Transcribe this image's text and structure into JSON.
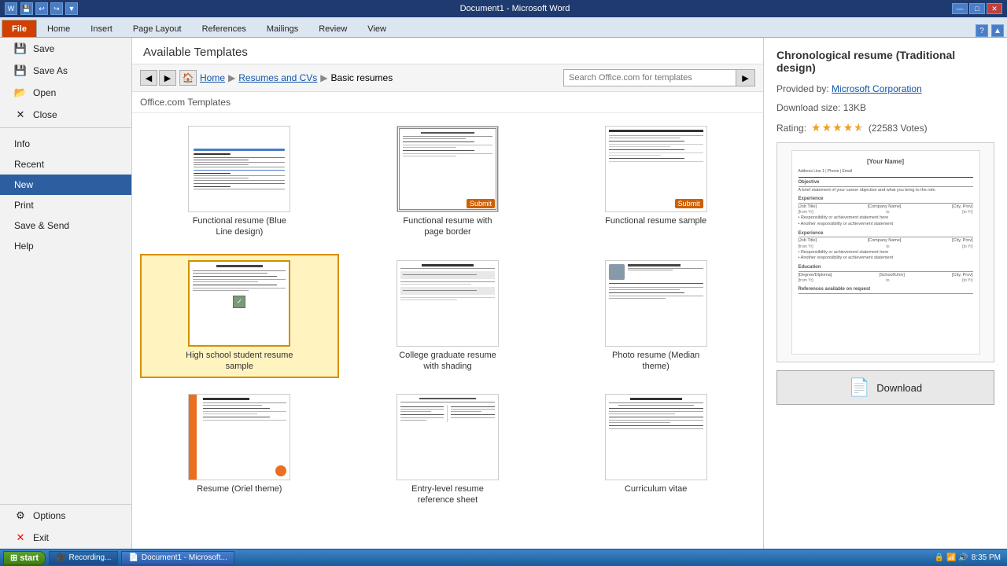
{
  "titleBar": {
    "title": "Document1  -  Microsoft Word",
    "controls": [
      "—",
      "□",
      "✕"
    ]
  },
  "tabs": [
    {
      "label": "File",
      "active": true
    },
    {
      "label": "Home",
      "active": false
    },
    {
      "label": "Insert",
      "active": false
    },
    {
      "label": "Page Layout",
      "active": false
    },
    {
      "label": "References",
      "active": false
    },
    {
      "label": "Mailings",
      "active": false
    },
    {
      "label": "Review",
      "active": false
    },
    {
      "label": "View",
      "active": false
    }
  ],
  "sidebar": {
    "items": [
      {
        "label": "Save",
        "icon": "💾",
        "active": false
      },
      {
        "label": "Save As",
        "icon": "💾",
        "active": false
      },
      {
        "label": "Open",
        "icon": "📂",
        "active": false
      },
      {
        "label": "Close",
        "icon": "✕",
        "active": false
      },
      {
        "label": "Info",
        "icon": "",
        "active": false
      },
      {
        "label": "Recent",
        "icon": "",
        "active": false
      },
      {
        "label": "New",
        "icon": "",
        "active": true
      },
      {
        "label": "Print",
        "icon": "",
        "active": false
      },
      {
        "label": "Save & Send",
        "icon": "",
        "active": false
      },
      {
        "label": "Help",
        "icon": "",
        "active": false
      },
      {
        "label": "Options",
        "icon": "⚙",
        "active": false
      },
      {
        "label": "Exit",
        "icon": "✕",
        "active": false
      }
    ]
  },
  "main": {
    "header": "Available Templates",
    "breadcrumb": {
      "home": "Home",
      "path": [
        "Resumes and CVs",
        "Basic resumes"
      ]
    },
    "search": {
      "placeholder": "Search Office.com for templates"
    },
    "subheader": "Office.com Templates",
    "templates": [
      {
        "label": "Functional resume (Blue Line design)",
        "selected": false,
        "hasSubmit": false,
        "type": "blue-line"
      },
      {
        "label": "Functional resume with page border",
        "selected": false,
        "hasSubmit": true,
        "type": "page-border"
      },
      {
        "label": "Functional resume sample",
        "selected": false,
        "hasSubmit": true,
        "type": "functional"
      },
      {
        "label": "High school student resume sample",
        "selected": true,
        "hasSubmit": false,
        "type": "highschool"
      },
      {
        "label": "College graduate resume with shading",
        "selected": false,
        "hasSubmit": false,
        "type": "college"
      },
      {
        "label": "Photo resume (Median theme)",
        "selected": false,
        "hasSubmit": false,
        "type": "photo"
      },
      {
        "label": "Resume (Oriel theme)",
        "selected": false,
        "hasSubmit": false,
        "type": "oriel"
      },
      {
        "label": "Entry-level resume reference sheet",
        "selected": false,
        "hasSubmit": false,
        "type": "entry"
      },
      {
        "label": "Curriculum vitae",
        "selected": false,
        "hasSubmit": false,
        "type": "cv"
      }
    ]
  },
  "rightPanel": {
    "title": "Chronological resume (Traditional design)",
    "provider": "Provided by:",
    "providerName": "Microsoft Corporation",
    "downloadSize": "Download size: 13KB",
    "rating": {
      "label": "Rating:",
      "votes": "22583 Votes",
      "starsCount": 4.5
    },
    "preview": {
      "yourName": "[Your Name]",
      "sections": [
        "Objective",
        "Experience",
        "Education"
      ]
    },
    "downloadBtn": "Download"
  },
  "taskbar": {
    "start": "start",
    "items": [
      {
        "label": "Recording...",
        "icon": "🎥"
      },
      {
        "label": "Document1 - Microsoft...",
        "icon": "📄"
      }
    ],
    "time": "8:35 PM"
  }
}
